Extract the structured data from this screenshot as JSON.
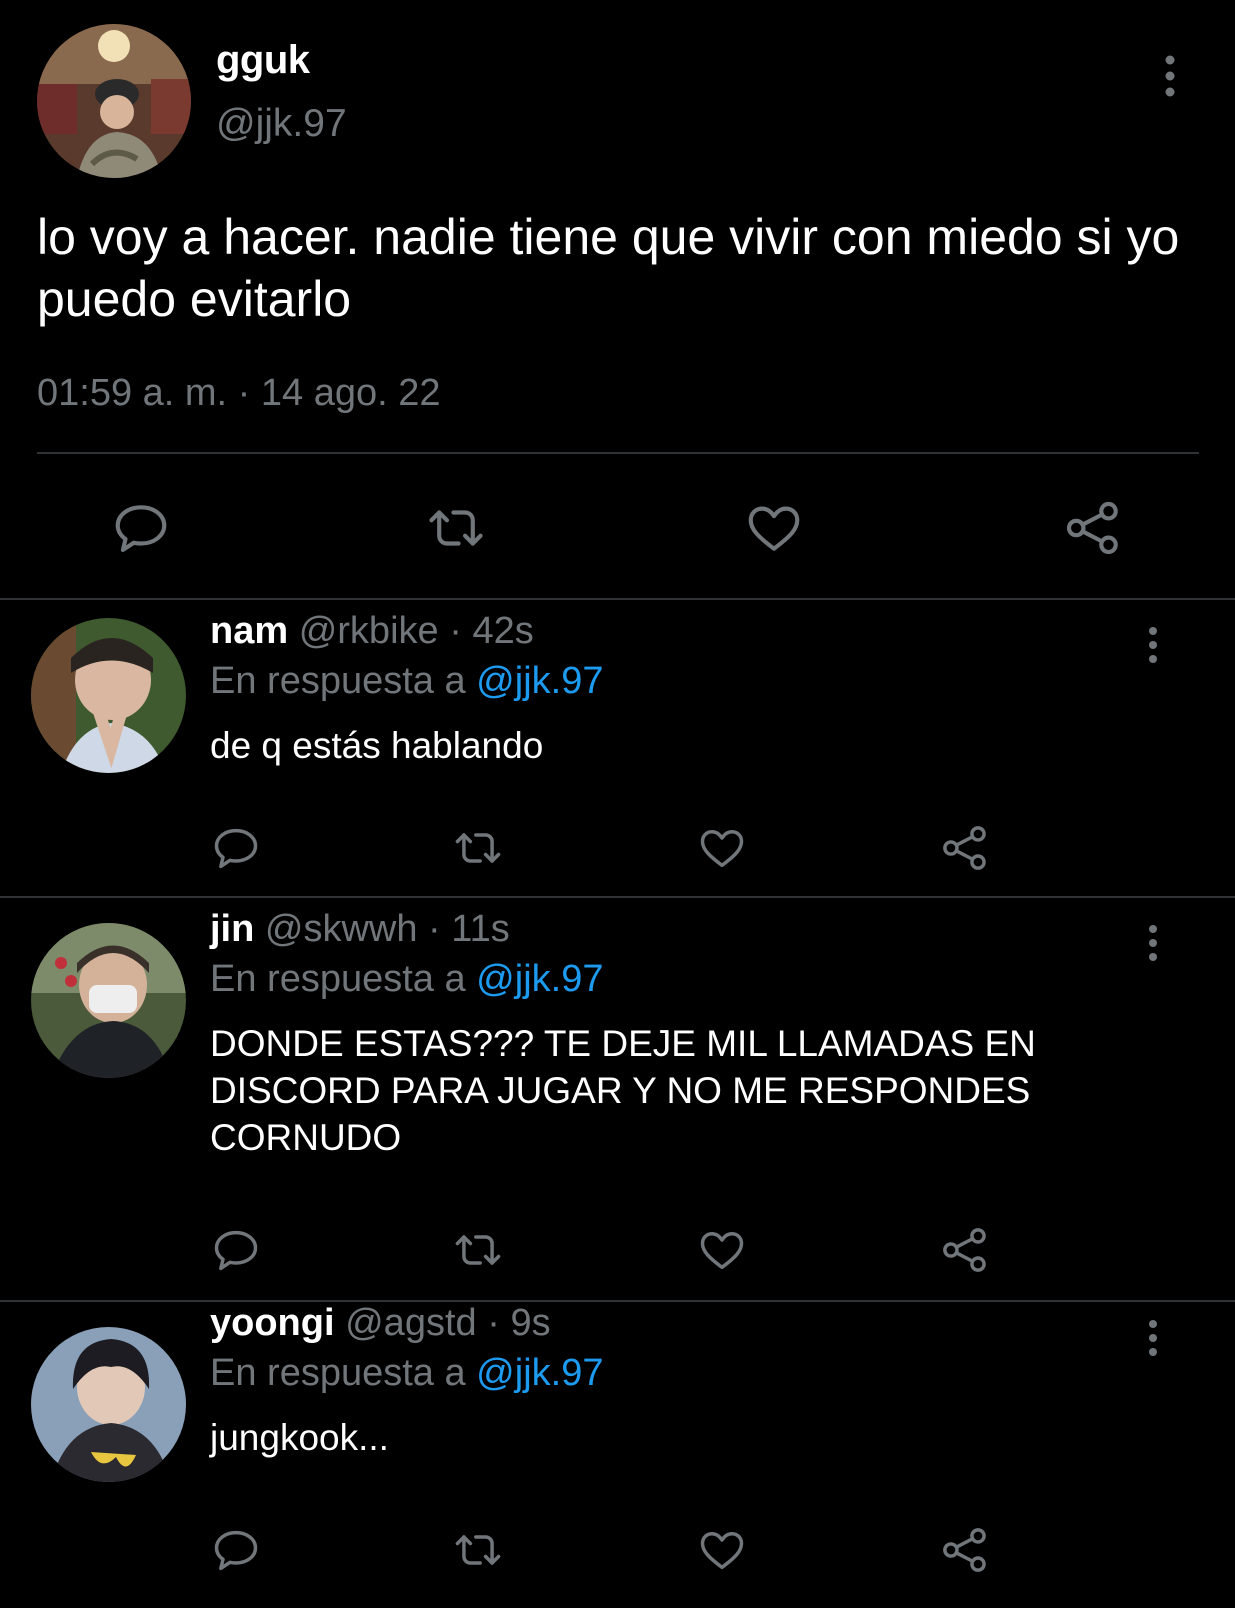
{
  "main_tweet": {
    "display_name": "gguk",
    "handle": "@jjk.97",
    "text": "lo voy a hacer. nadie tiene que vivir con miedo si yo puedo evitarlo",
    "timestamp": "01:59 a. m. · 14 ago. 22",
    "actions": [
      "reply-icon",
      "retweet-icon",
      "like-icon",
      "share-icon"
    ]
  },
  "replies": [
    {
      "display_name": "nam",
      "handle": "@rkbike",
      "separator": " · ",
      "time": "42s",
      "reply_prefix": "En respuesta a ",
      "reply_to": "@jjk.97",
      "text": "de q estás hablando"
    },
    {
      "display_name": "jin",
      "handle": "@skwwh",
      "separator": " · ",
      "time": "11s",
      "reply_prefix": "En respuesta a ",
      "reply_to": "@jjk.97",
      "text": "DONDE ESTAS??? TE DEJE MIL LLAMADAS EN DISCORD PARA JUGAR Y NO ME RESPONDES CORNUDO"
    },
    {
      "display_name": "yoongi",
      "handle": "@agstd",
      "separator": " · ",
      "time": "9s",
      "reply_prefix": "En respuesta a ",
      "reply_to": "@jjk.97",
      "text": "jungkook..."
    }
  ],
  "colors": {
    "background": "#000000",
    "primary_text": "#ffffff",
    "secondary_text": "#71767b",
    "link": "#1d9bf0",
    "divider": "#2f3336"
  }
}
